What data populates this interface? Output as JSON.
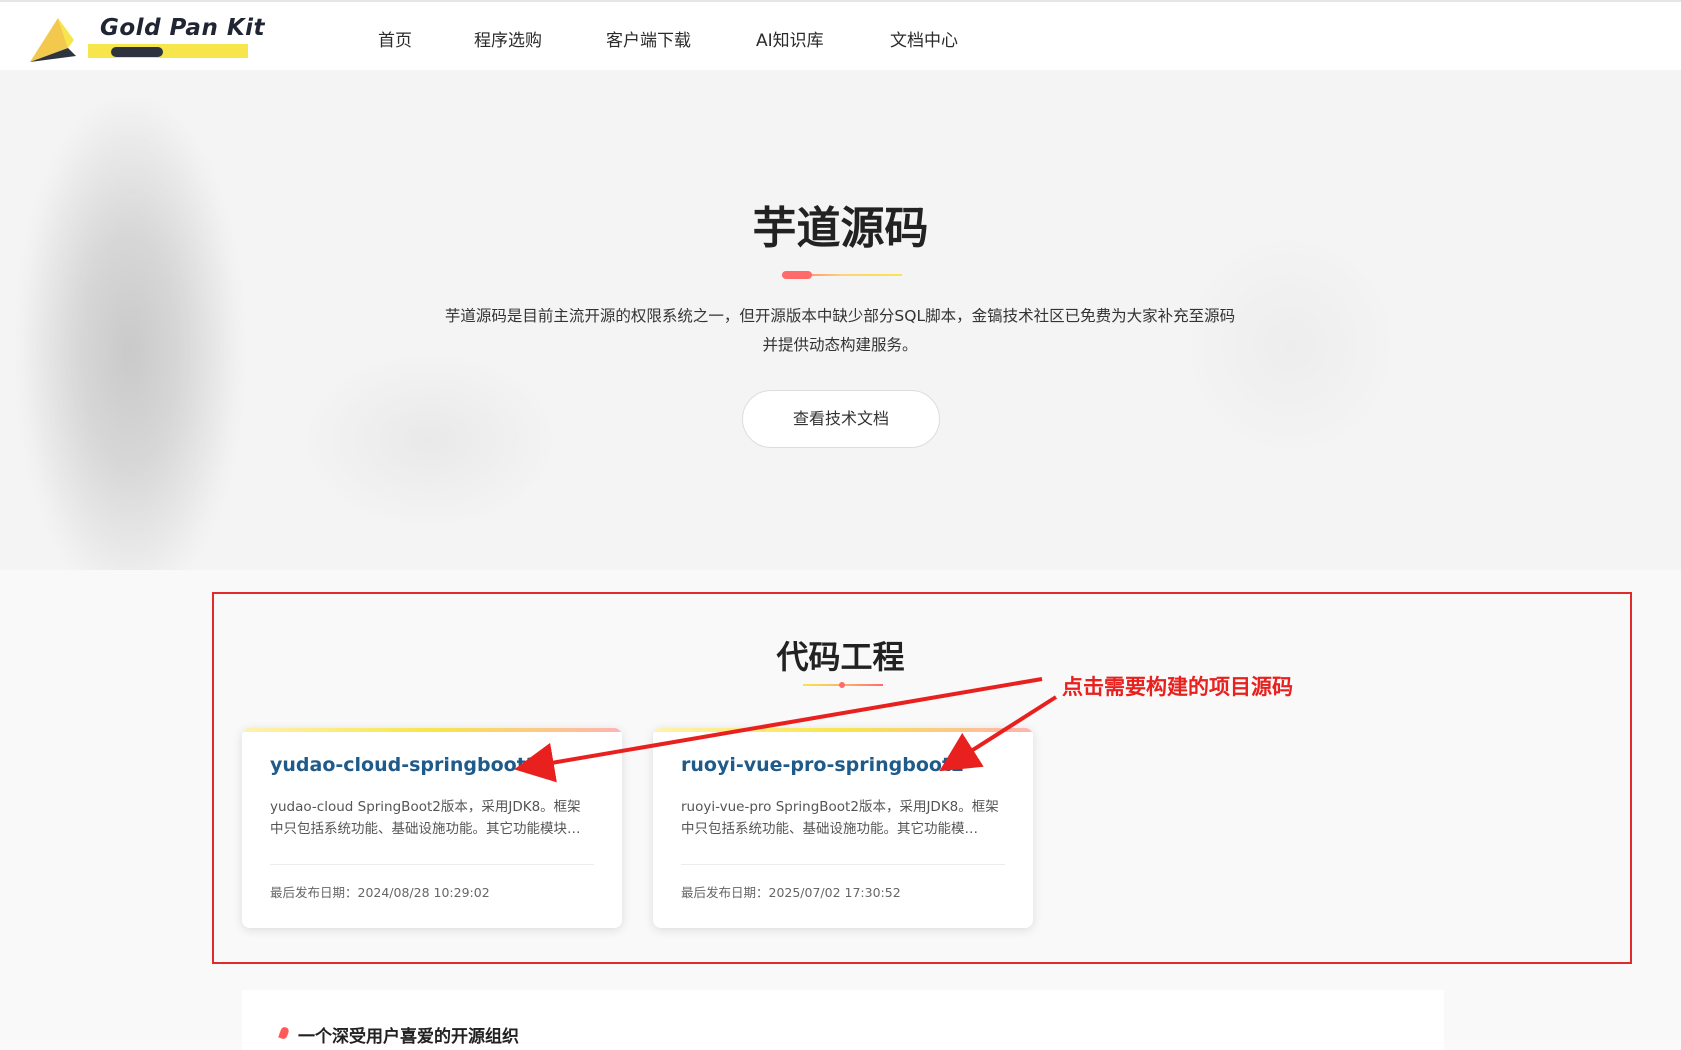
{
  "header": {
    "logo_text": "Gold Pan Kit",
    "nav": [
      {
        "label": "首页"
      },
      {
        "label": "程序选购"
      },
      {
        "label": "客户端下载"
      },
      {
        "label": "AI知识库"
      },
      {
        "label": "文档中心"
      }
    ]
  },
  "hero": {
    "title": "芋道源码",
    "description": "芋道源码是目前主流开源的权限系统之一，但开源版本中缺少部分SQL脚本，金镐技术社区已免费为大家补充至源码并提供动态构建服务。",
    "button_label": "查看技术文档"
  },
  "projects": {
    "title": "代码工程",
    "annotation": "点击需要构建的项目源码",
    "cards": [
      {
        "title": "yudao-cloud-springboot2",
        "description": "yudao-cloud SpringBoot2版本，采用JDK8。框架中只包括系统功能、基础设施功能。其它功能模块…",
        "date": "最后发布日期：2024/08/28 10:29:02"
      },
      {
        "title": "ruoyi-vue-pro-springboot2",
        "description": "ruoyi-vue-pro SpringBoot2版本，采用JDK8。框架中只包括系统功能、基础设施功能。其它功能模…",
        "date": "最后发布日期：2025/07/02 17:30:52"
      }
    ]
  },
  "bottom": {
    "heading": "一个深受用户喜爱的开源组织"
  },
  "colors": {
    "annotation_red": "#e8201e",
    "card_title_blue": "#1e5a8a",
    "logo_yellow": "#f7e64b"
  }
}
